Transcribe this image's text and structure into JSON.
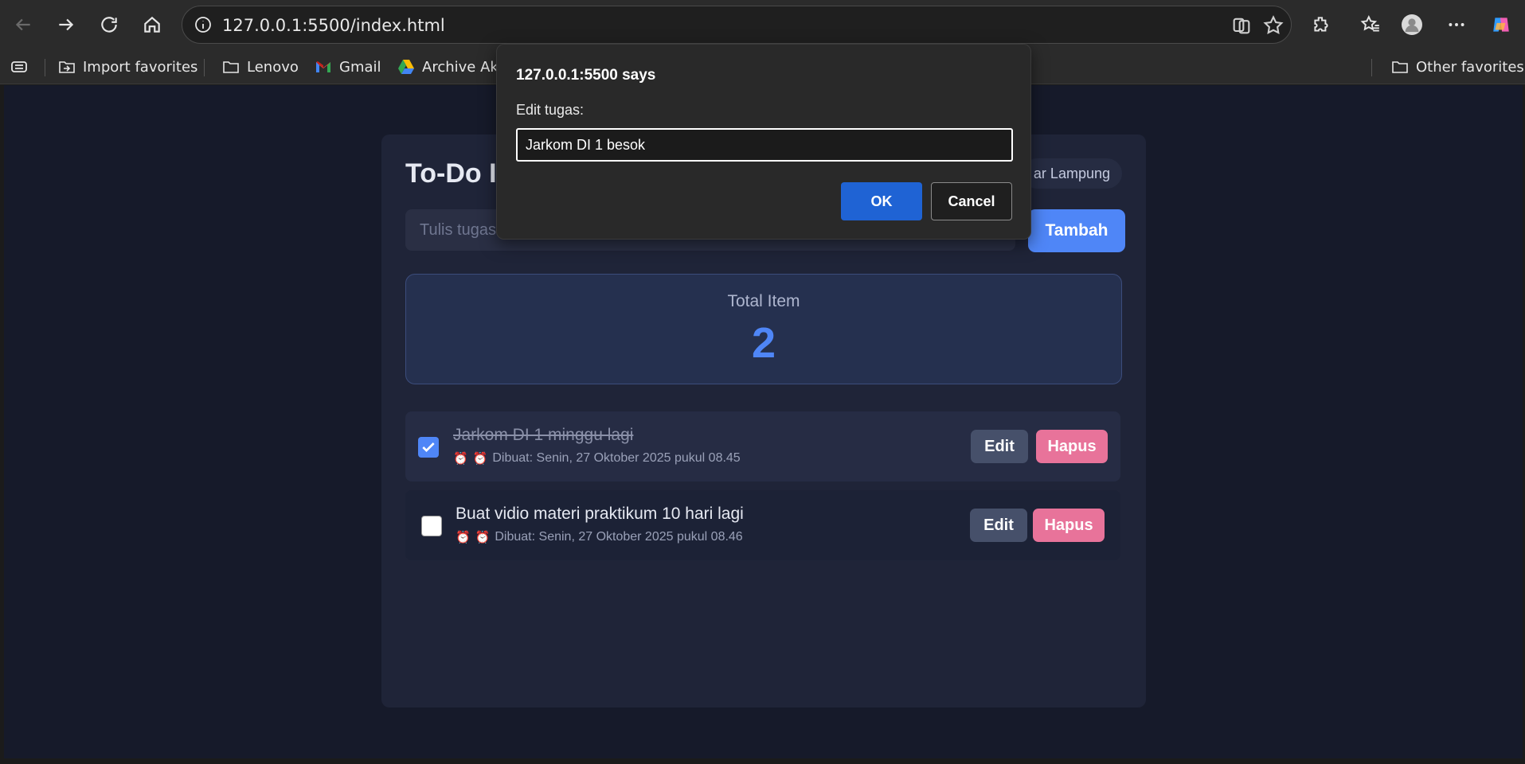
{
  "browser": {
    "url": "127.0.0.1:5500/index.html",
    "icons": [
      "back-icon",
      "forward-icon",
      "reload-icon",
      "home-icon",
      "site-info-icon",
      "copilot-page-icon",
      "star-icon",
      "extensions-icon",
      "favorites-icon",
      "profile-icon",
      "more-icon",
      "copilot-icon"
    ],
    "bookmarks": [
      {
        "label": "Import favorites",
        "icon": "import-icon"
      },
      {
        "label": "Lenovo",
        "icon": "folder-icon"
      },
      {
        "label": "Gmail",
        "icon": "gmail-icon"
      },
      {
        "label": "Archive Aka",
        "icon": "drive-icon"
      }
    ],
    "other_favorites": "Other favorites"
  },
  "app": {
    "title": "To-Do I",
    "location": "ar Lampung",
    "input_placeholder": "Tulis tugas",
    "add_label": "Tambah",
    "stats": {
      "label": "Total Item",
      "value": "2"
    },
    "tasks": [
      {
        "text": "Jarkom DI 1 minggu lagi",
        "meta": "Dibuat: Senin, 27 Oktober 2025 pukul 08.45",
        "done": true,
        "edit": "Edit",
        "delete": "Hapus"
      },
      {
        "text": "Buat vidio materi praktikum 10 hari lagi",
        "meta": "Dibuat: Senin, 27 Oktober 2025 pukul 08.46",
        "done": false,
        "edit": "Edit",
        "delete": "Hapus"
      }
    ]
  },
  "dialog": {
    "title": "127.0.0.1:5500 says",
    "message": "Edit tugas:",
    "value": "Jarkom DI 1 besok",
    "ok": "OK",
    "cancel": "Cancel"
  },
  "colors": {
    "accent": "#4f86f7",
    "danger": "#e8739a",
    "dialog_ok": "#1f63d4"
  }
}
